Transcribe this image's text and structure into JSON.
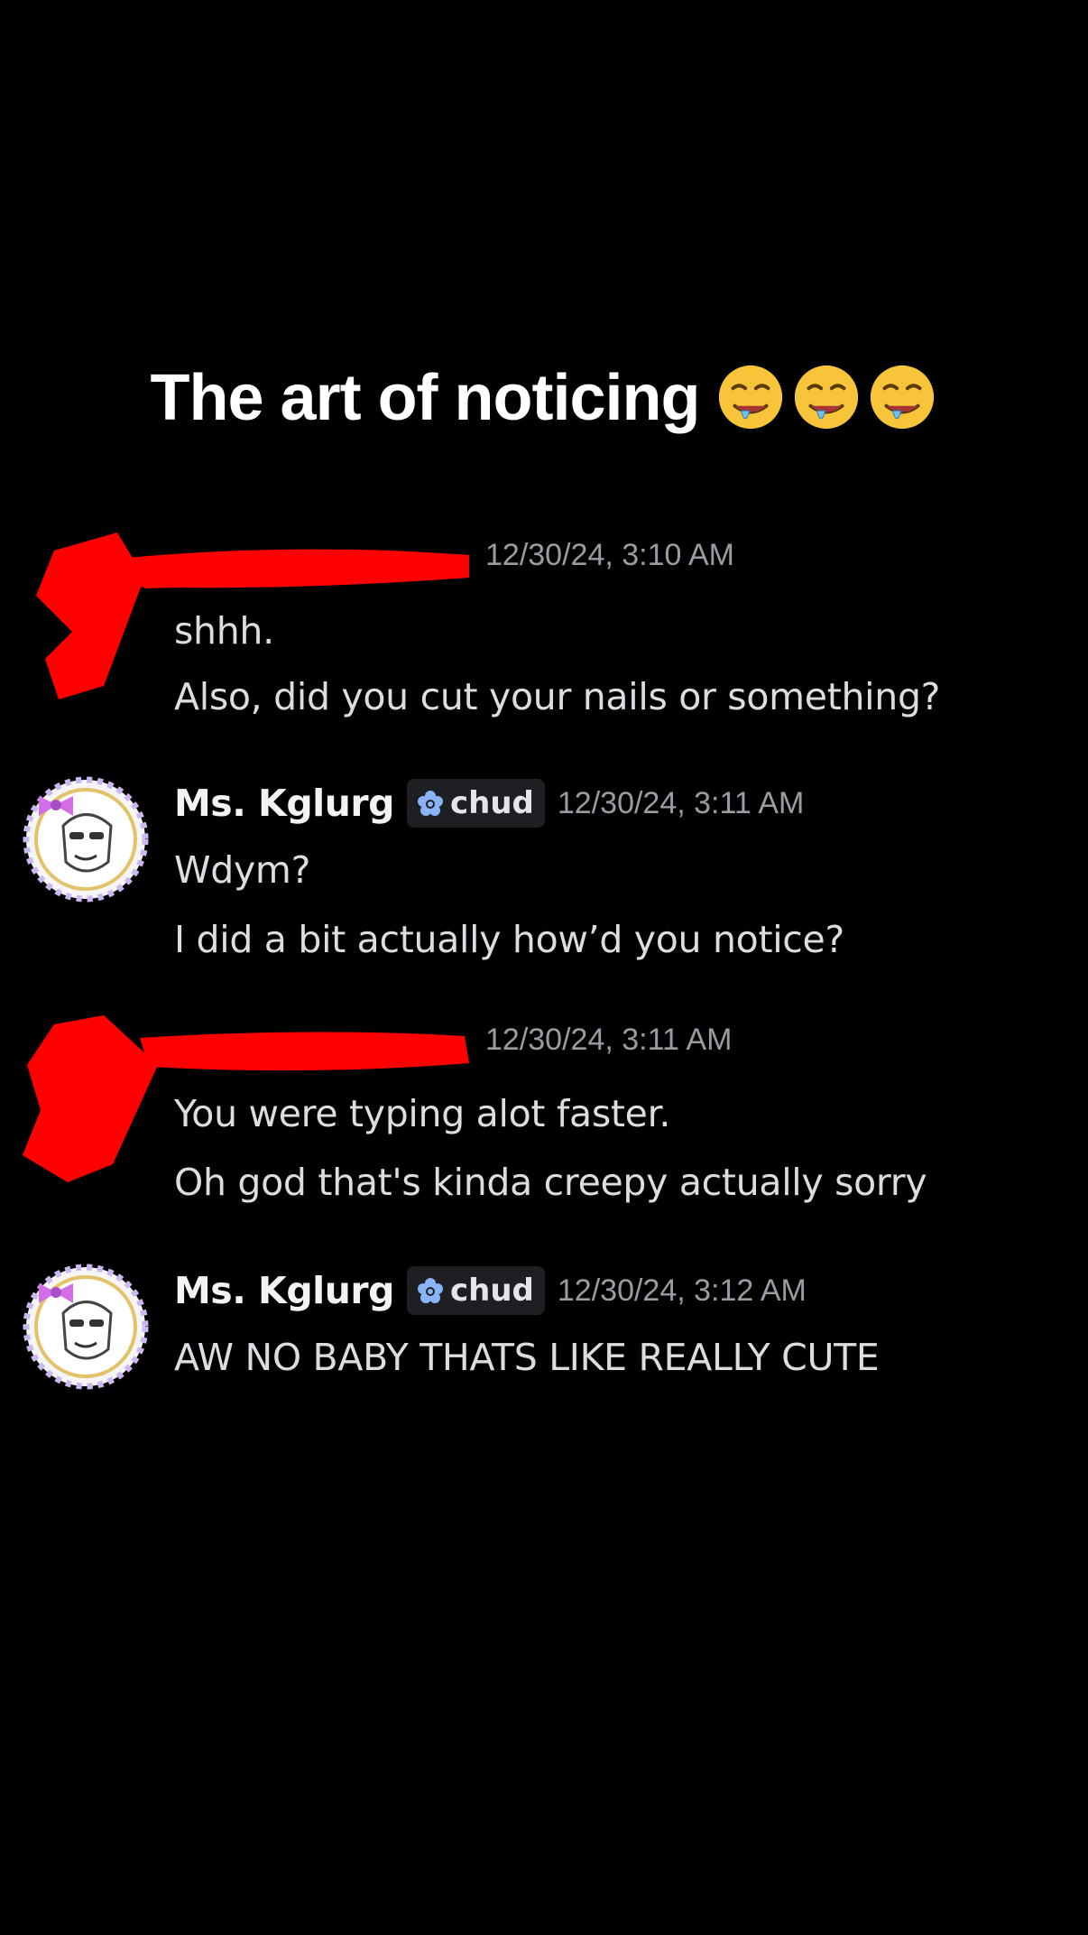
{
  "caption": {
    "text": "The art of noticing",
    "emoji": [
      "drooling-face",
      "drooling-face",
      "drooling-face"
    ]
  },
  "messages": [
    {
      "author": "",
      "author_redacted": true,
      "timestamp": "12/30/24, 3:10 AM",
      "lines": [
        "shhh.",
        "Also, did you cut your nails or something?"
      ]
    },
    {
      "author": "Ms. Kglurg",
      "tag": "chud",
      "tag_icon": "flower-icon",
      "timestamp": "12/30/24, 3:11 AM",
      "lines": [
        "Wdym?",
        "I did a bit actually how’d you notice?"
      ]
    },
    {
      "author": "",
      "author_redacted": true,
      "timestamp": "12/30/24, 3:11 AM",
      "lines": [
        "You were typing alot faster.",
        "Oh god that's kinda creepy actually sorry"
      ]
    },
    {
      "author": "Ms. Kglurg",
      "tag": "chud",
      "tag_icon": "flower-icon",
      "timestamp": "12/30/24, 3:12 AM",
      "lines": [
        "AW NO BABY THATS LIKE REALLY CUTE"
      ]
    }
  ],
  "colors": {
    "background": "#000000",
    "username": "#f2f3f5",
    "message_text": "#dbdee1",
    "timestamp": "#9a9ca3",
    "tag_background": "#1e1f22",
    "tag_icon": "#8ab4f8",
    "redaction": "#ff0000"
  }
}
